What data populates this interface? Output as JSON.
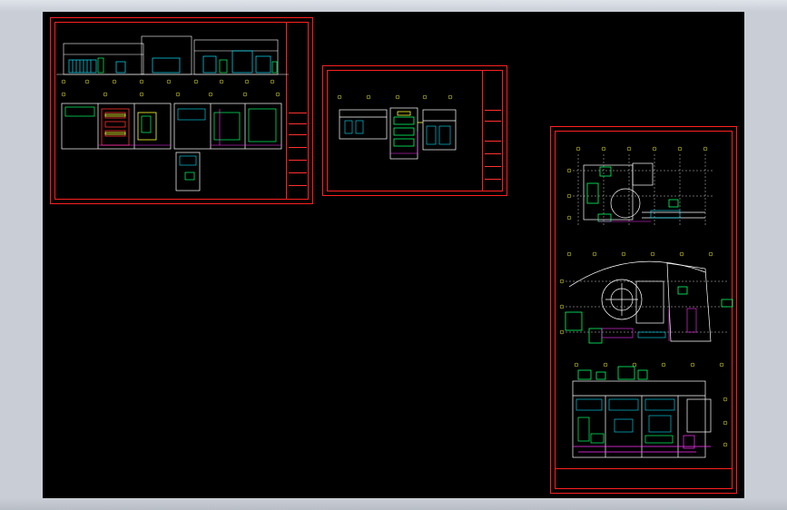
{
  "colors": {
    "background": "#000000",
    "frame": "#ff2020",
    "wall": "#ffffff",
    "equipment": "#00ff66",
    "cyan": "#00e5ff",
    "magenta": "#ff33ff",
    "yellow": "#ffff33"
  },
  "sheets": [
    {
      "id": "sheet-1",
      "title_block": {
        "label": ""
      }
    },
    {
      "id": "sheet-2",
      "title_block": {
        "label": ""
      }
    },
    {
      "id": "sheet-3",
      "title_block": {
        "label": ""
      }
    }
  ]
}
